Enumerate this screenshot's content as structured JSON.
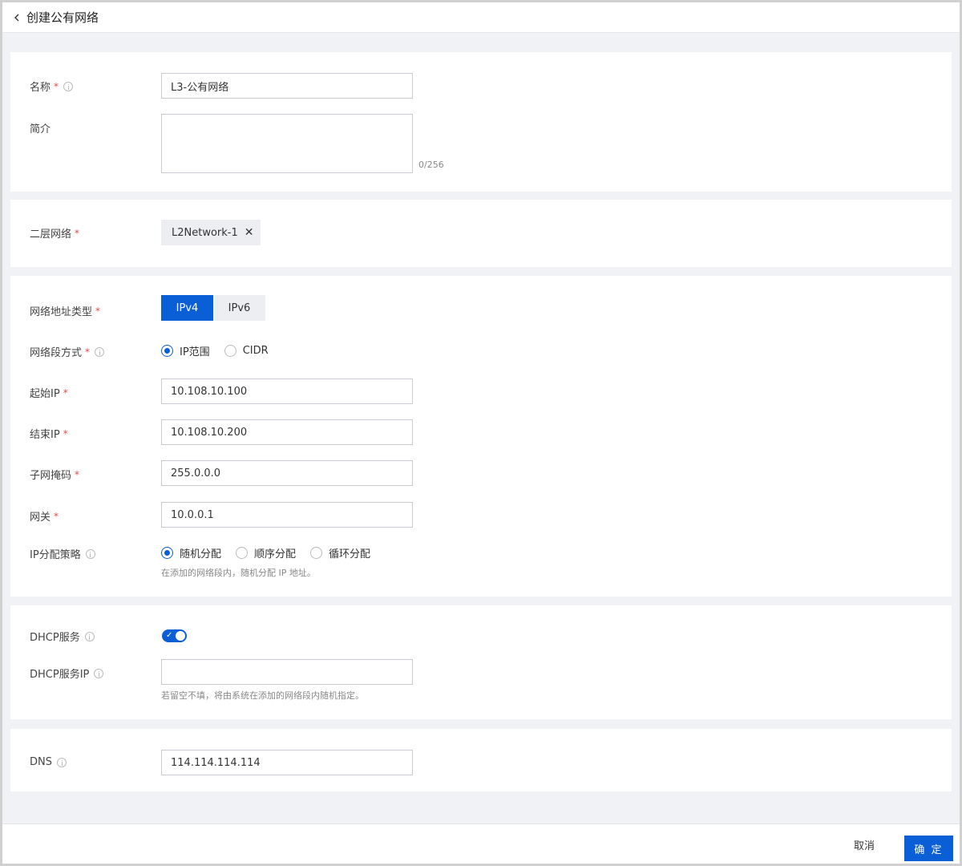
{
  "header": {
    "title": "创建公有网络"
  },
  "basic": {
    "name_label": "名称",
    "name_value": "L3-公有网络",
    "desc_label": "简介",
    "desc_counter": "0/256"
  },
  "l2": {
    "label": "二层网络",
    "tag": "L2Network-1"
  },
  "network": {
    "addr_type_label": "网络地址类型",
    "addr_types": [
      "IPv4",
      "IPv6"
    ],
    "segment_label": "网络段方式",
    "segment_options": [
      "IP范围",
      "CIDR"
    ],
    "start_ip_label": "起始IP",
    "start_ip": "10.108.10.100",
    "end_ip_label": "结束IP",
    "end_ip": "10.108.10.200",
    "mask_label": "子网掩码",
    "mask": "255.0.0.0",
    "gateway_label": "网关",
    "gateway": "10.0.0.1",
    "policy_label": "IP分配策略",
    "policy_options": [
      "随机分配",
      "顺序分配",
      "循环分配"
    ],
    "policy_hint": "在添加的网络段内，随机分配 IP 地址。"
  },
  "dhcp": {
    "service_label": "DHCP服务",
    "ip_label": "DHCP服务IP",
    "ip_value": "",
    "hint": "若留空不填，将由系统在添加的网络段内随机指定。"
  },
  "dns": {
    "label": "DNS",
    "value": "114.114.114.114"
  },
  "footer": {
    "cancel": "取消",
    "ok": "确 定"
  },
  "colors": {
    "primary": "#0a5fd6",
    "required": "#e5484d"
  }
}
